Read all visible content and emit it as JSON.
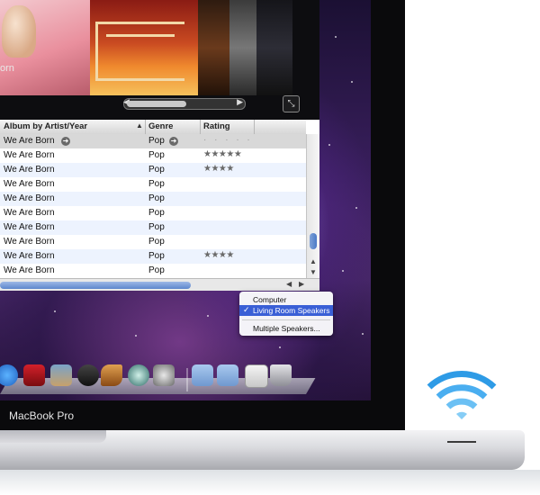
{
  "coverflow": {
    "caption": "orn"
  },
  "songlist": {
    "columns": {
      "album": "Album by Artist/Year",
      "genre": "Genre",
      "rating": "Rating"
    },
    "rows": [
      {
        "album": "We Are Born",
        "genre": "Pop",
        "rating": "· · · · ·",
        "stars": 0
      },
      {
        "album": "We Are Born",
        "genre": "Pop",
        "rating": "★★★★★",
        "stars": 5
      },
      {
        "album": "We Are Born",
        "genre": "Pop",
        "rating": "★★★★",
        "stars": 4
      },
      {
        "album": "We Are Born",
        "genre": "Pop",
        "rating": "",
        "stars": 0
      },
      {
        "album": "We Are Born",
        "genre": "Pop",
        "rating": "",
        "stars": 0
      },
      {
        "album": "We Are Born",
        "genre": "Pop",
        "rating": "",
        "stars": 0
      },
      {
        "album": "We Are Born",
        "genre": "Pop",
        "rating": "",
        "stars": 0
      },
      {
        "album": "We Are Born",
        "genre": "Pop",
        "rating": "",
        "stars": 0
      },
      {
        "album": "We Are Born",
        "genre": "Pop",
        "rating": "★★★★",
        "stars": 4
      },
      {
        "album": "We Are Born",
        "genre": "Pop",
        "rating": "",
        "stars": 0
      }
    ]
  },
  "airplay_menu": {
    "items": [
      "Computer",
      "Living Room Speakers",
      "Multiple Speakers..."
    ],
    "selected": "Living Room Speakers"
  },
  "dock": {
    "icons": [
      "itunes-icon",
      "photo-booth-icon",
      "iphoto-icon",
      "imovie-icon",
      "garageband-icon",
      "time-machine-icon",
      "system-preferences-icon",
      "applications-folder-icon",
      "documents-folder-icon",
      "downloads-stack-icon",
      "trash-icon"
    ]
  },
  "laptop": {
    "label": "MacBook Pro"
  },
  "colors": {
    "menu_highlight": "#3a5fd6",
    "wifi": "#2e9be6"
  }
}
